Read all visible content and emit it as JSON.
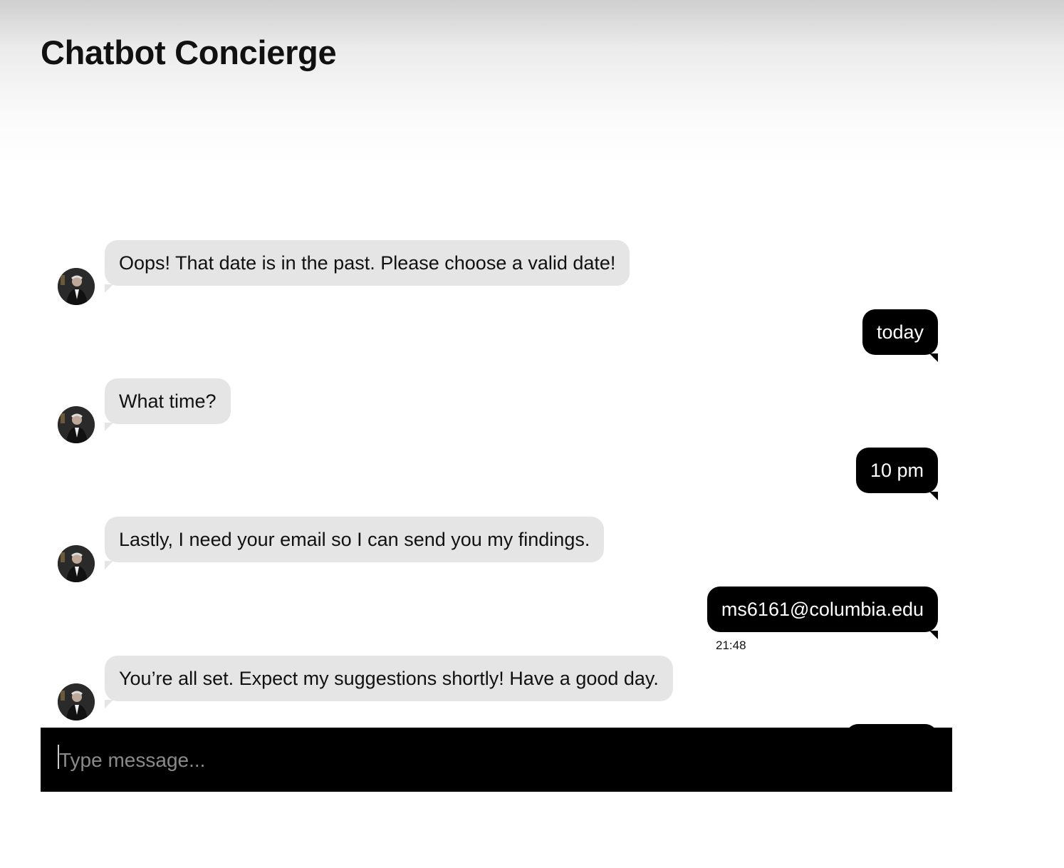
{
  "header": {
    "title": "Chatbot Concierge"
  },
  "conversation": {
    "messages": [
      {
        "sender": "bot",
        "text": "Oops! That date is in the past. Please choose a valid date!"
      },
      {
        "sender": "user",
        "text": "today"
      },
      {
        "sender": "bot",
        "text": "What time?"
      },
      {
        "sender": "user",
        "text": "10 pm"
      },
      {
        "sender": "bot",
        "text": "Lastly, I need your email so I can send you my findings."
      },
      {
        "sender": "user",
        "text": "ms6161@columbia.edu",
        "timestamp": "21:48"
      },
      {
        "sender": "bot",
        "text": "You’re all set. Expect my suggestions shortly! Have a good day."
      }
    ]
  },
  "composer": {
    "placeholder": "Type message..."
  },
  "colors": {
    "bot_bubble": "#e5e5e5",
    "user_bubble": "#000000",
    "composer_background": "#000000"
  },
  "icons": {
    "bot_avatar": "bot-avatar-photo"
  }
}
